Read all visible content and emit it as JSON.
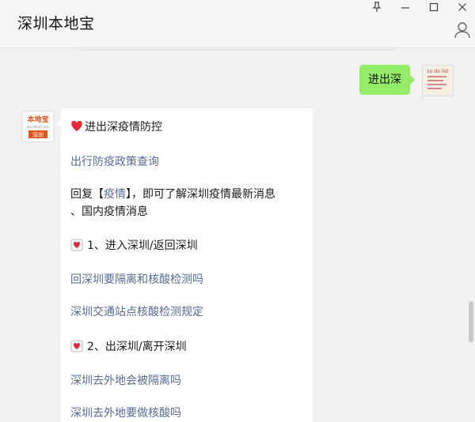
{
  "window": {
    "title": "深圳本地宝"
  },
  "chat": {
    "outgoing": {
      "text": "进出深"
    },
    "me_avatar_text": "Lo do list",
    "bot_avatar": {
      "top_text": "本地宝",
      "mid_text": "bendibao.com",
      "bottom_text": "深圳"
    },
    "reply": {
      "heading": "进出深疫情防控",
      "link1": "出行防疫政策查询",
      "reply_prefix": "回复【",
      "reply_keyword": "疫情",
      "reply_suffix": "】，即可了解深圳疫情最新消息",
      "reply_line2": "、国内疫情消息",
      "section1": "1、进入深圳/返回深圳",
      "link2": "回深圳要隔离和核酸检测吗",
      "link3": "深圳交通站点核酸检测规定",
      "section2": "2、出深圳/离开深圳",
      "link4": "深圳去外地会被隔离吗",
      "link5": "深圳去外地要做核酸吗"
    }
  },
  "colors": {
    "outgoing_bubble": "#95ec69",
    "link": "#576b95",
    "heart": "#e8283a"
  }
}
